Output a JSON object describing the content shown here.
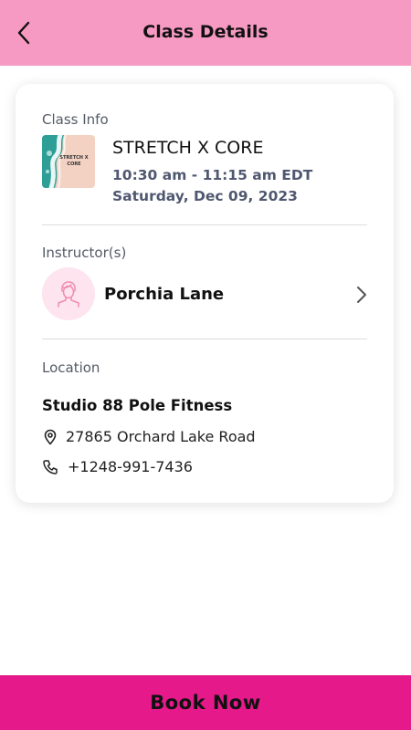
{
  "header": {
    "title": "Class Details"
  },
  "class_info": {
    "section_label": "Class Info",
    "thumbnail_text_line1": "STRETCH X",
    "thumbnail_text_line2": "CORE",
    "name": "STRETCH X CORE",
    "time": "10:30 am - 11:15 am EDT",
    "date": "Saturday, Dec 09, 2023"
  },
  "instructor": {
    "section_label": "Instructor(s)",
    "name": "Porchia Lane"
  },
  "location": {
    "section_label": "Location",
    "studio": "Studio 88 Pole Fitness",
    "address": "27865 Orchard Lake Road",
    "phone": "+1248-991-7436"
  },
  "footer": {
    "book_label": "Book Now"
  },
  "colors": {
    "header_bg": "#f69ac3",
    "book_bg": "#e6198a",
    "avatar_bg": "#fde4ee",
    "avatar_icon": "#f08cb0"
  }
}
